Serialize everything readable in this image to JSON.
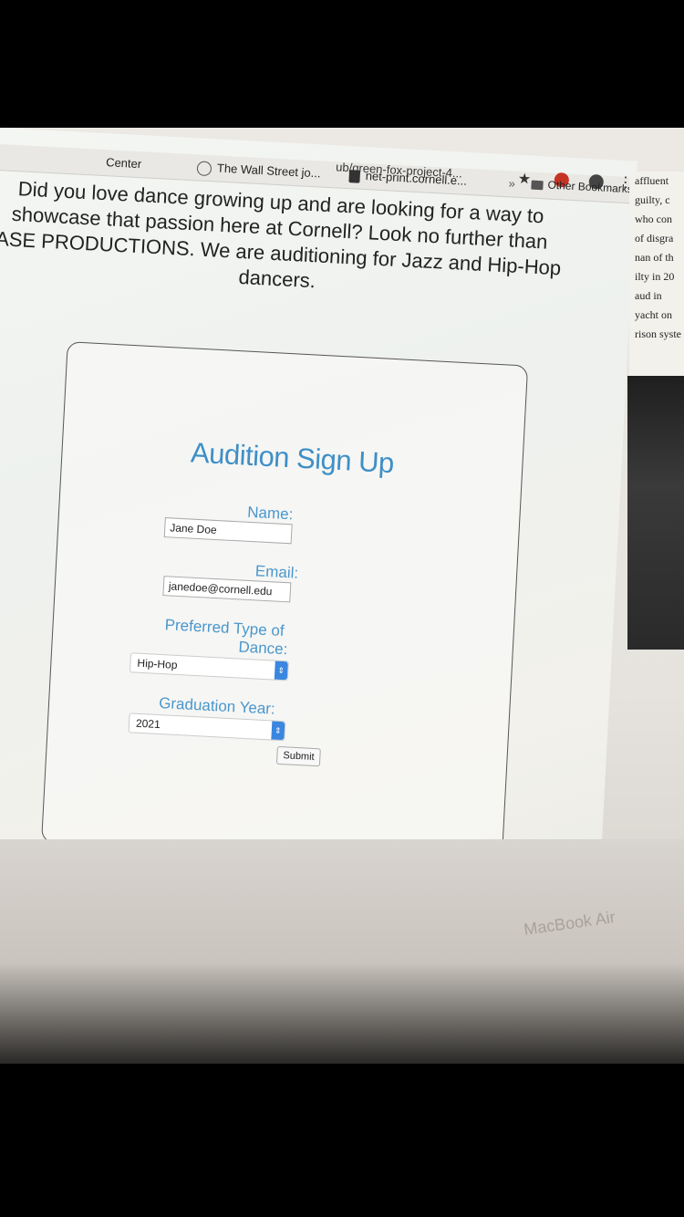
{
  "browser": {
    "url": "ub/green-fox-project-4...",
    "bookmarks": [
      "Center",
      "The Wall Street jo...",
      "net-print.cornell.e..."
    ],
    "overflow": "»",
    "other_bookmarks": "Other Bookmarks",
    "star_icon": "★",
    "menu_icon": "⋮"
  },
  "page": {
    "intro_lines": [
      "Did you love dance growing up and are looking for a way to",
      "showcase that passion here at Cornell? Look no further than",
      "ASE PRODUCTIONS. We are auditioning for Jazz and Hip-Hop",
      "dancers."
    ]
  },
  "form": {
    "title": "Audition Sign Up",
    "name_label": "Name:",
    "name_value": "Jane Doe",
    "email_label": "Email:",
    "email_value": "janedoe@cornell.edu",
    "dance_label_1": "Preferred Type of",
    "dance_label_2": "Dance:",
    "dance_value": "Hip-Hop",
    "year_label": "Graduation Year:",
    "year_value": "2021",
    "submit_label": "Submit"
  },
  "newspaper_lines": [
    "affluent",
    "guilty, c",
    "who con",
    "of disgra",
    "nan of th",
    "ilty in 20",
    "aud in",
    "yacht on",
    "rison syste"
  ],
  "device_label": "MacBook Air"
}
